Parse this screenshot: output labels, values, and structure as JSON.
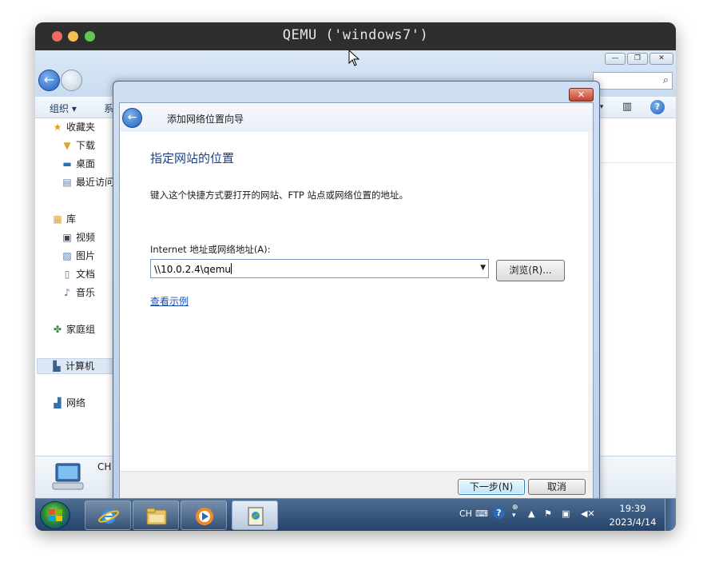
{
  "host": {
    "title": "QEMU ('windows7')"
  },
  "explorer": {
    "toolbar": {
      "organize": "组织 ▾",
      "system": "系"
    },
    "nav": {
      "favorites": "收藏夹",
      "downloads": "下载",
      "desktop": "桌面",
      "recent": "最近访问",
      "libraries": "库",
      "videos": "视频",
      "pictures": "图片",
      "documents": "文档",
      "music": "音乐",
      "homegroup": "家庭组",
      "computer": "计算机",
      "network": "网络"
    },
    "details_text": "CH"
  },
  "dialog": {
    "title": "添加网络位置向导",
    "heading": "指定网站的位置",
    "description": "键入这个快捷方式要打开的网站、FTP 站点或网络位置的地址。",
    "address_label": "Internet 地址或网络地址(A):",
    "address_value": "\\\\10.0.2.4\\qemu",
    "browse_label": "浏览(R)...",
    "example_link": "查看示例",
    "next_label": "下一步(N)",
    "cancel_label": "取消"
  },
  "taskbar": {
    "tray": {
      "lang": "CH"
    },
    "time": "19:39",
    "date": "2023/4/14"
  },
  "colors": {
    "accent": "#1a3e8c",
    "link": "#1a4fb5",
    "taskbar": "#25436b"
  }
}
